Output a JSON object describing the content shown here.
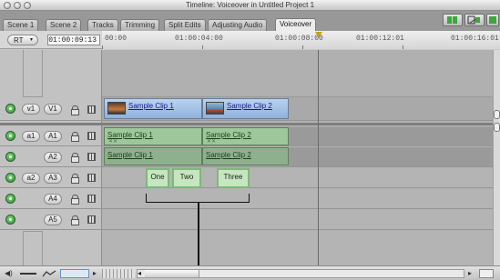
{
  "window": {
    "title": "Timeline: Voiceover in Untitled Project 1"
  },
  "tabs": [
    {
      "label": "Scene 1"
    },
    {
      "label": "Scene 2"
    },
    {
      "label": "Tracks"
    },
    {
      "label": "Trimming"
    },
    {
      "label": "Split Edits"
    },
    {
      "label": "Adjusting Audio"
    },
    {
      "label": "Voiceover"
    }
  ],
  "active_tab": "Voiceover",
  "controls": {
    "rt_label": "RT",
    "timecode": "01:00:09:13"
  },
  "ruler": {
    "labels": [
      "00:00",
      "01:00:04:00",
      "01:00:08:00",
      "01:00:12:01",
      "01:00:16:01"
    ]
  },
  "tracks": {
    "v1": {
      "source": "v1",
      "dest": "V1"
    },
    "a1": {
      "source": "a1",
      "dest": "A1"
    },
    "a2": {
      "source": "",
      "dest": "A2"
    },
    "a3": {
      "source": "a2",
      "dest": "A3"
    },
    "a4": {
      "source": "",
      "dest": "A4"
    },
    "a5": {
      "source": "",
      "dest": "A5"
    }
  },
  "clips": {
    "video": [
      "Sample Clip 1",
      "Sample Clip 2"
    ],
    "audio_a1": [
      "Sample Clip 1",
      "Sample Clip 2"
    ],
    "audio_a2": [
      "Sample Clip 1",
      "Sample Clip 2"
    ],
    "voiceover": [
      "One",
      "Two",
      "Three"
    ]
  },
  "colors": {
    "video_clip": "#9fbfe6",
    "audio_clip": "#9ec79b",
    "voiceover_clip": "#c6e6bf",
    "visibility_on": "#3aa83a"
  }
}
